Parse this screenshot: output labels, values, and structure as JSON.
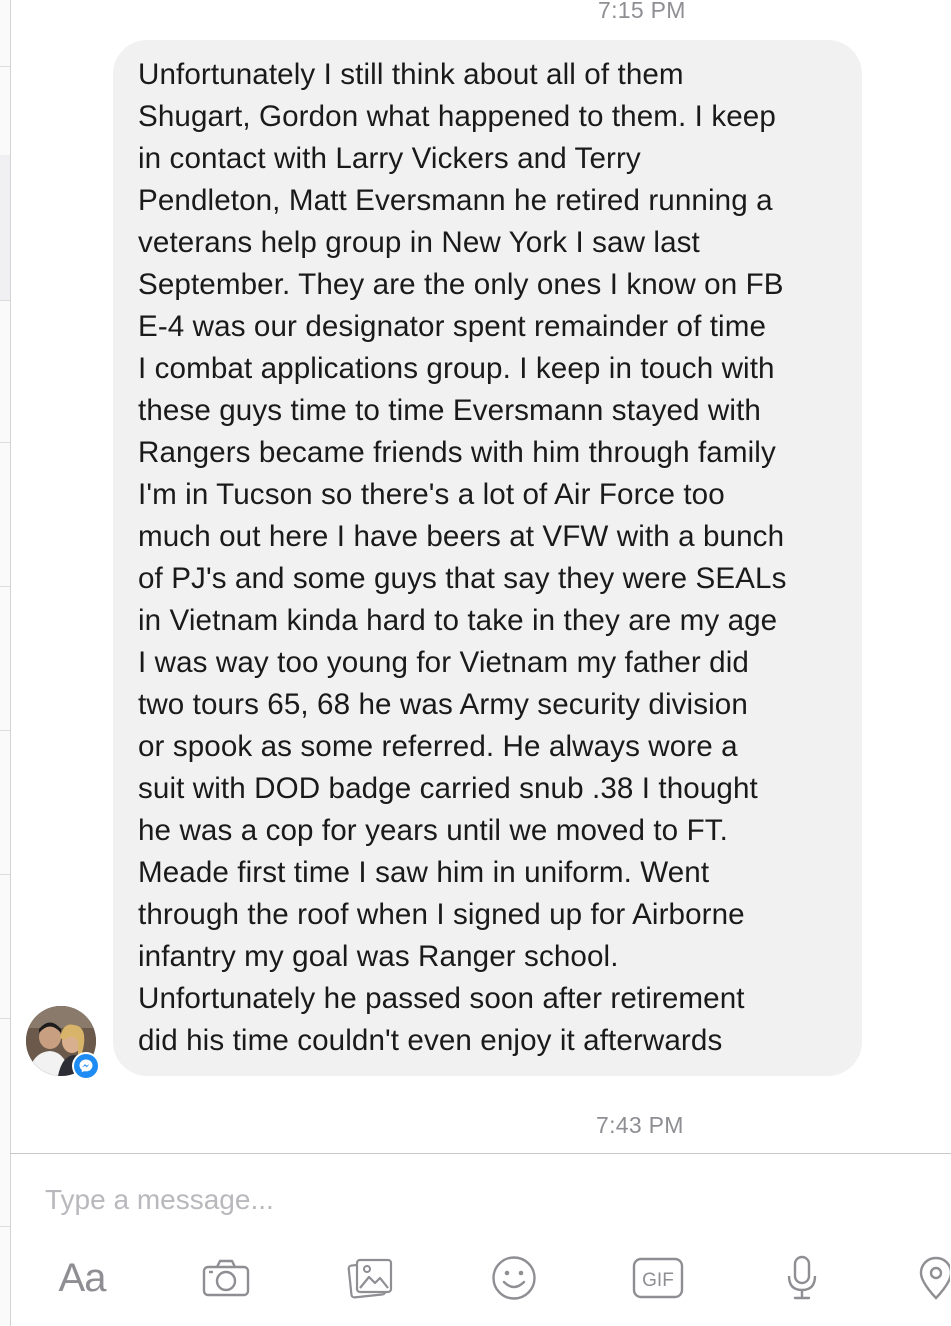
{
  "conversation": {
    "timestamp_top": "7:15 PM",
    "timestamp_bottom": "7:43 PM",
    "message": {
      "lines": [
        "Unfortunately I still think about all of them",
        "Shugart, Gordon what happened to them. I keep",
        "in contact with Larry Vickers and Terry",
        "Pendleton, Matt Eversmann he retired running a",
        "veterans help group in New York I saw last",
        "September. They are the only ones I know on FB",
        "E-4 was our designator spent remainder of time",
        "I combat applications group. I keep in touch with",
        "these guys time to time Eversmann stayed with",
        "Rangers became friends with him through family",
        "I'm in Tucson so there's a lot of Air Force too",
        "much out here I have beers at VFW with a bunch",
        "of PJ's and some guys that say they were SEALs",
        "in Vietnam kinda hard to take in they are my age",
        "I was way too young for Vietnam my father did",
        "two tours 65, 68 he was Army security division",
        "or spook as some referred. He always wore a",
        "suit with DOD badge carried snub .38 I thought",
        "he was a cop for years until we moved to FT.",
        "Meade first time I saw him in uniform. Went",
        "through the roof when I signed up for Airborne",
        "infantry my goal was Ranger school.",
        "Unfortunately he passed soon after retirement",
        "did his time couldn't even enjoy it afterwards"
      ]
    }
  },
  "composer": {
    "placeholder": "Type a message...",
    "value": "",
    "text_format_label": "Aa",
    "gif_label": "GIF",
    "icons": [
      "text-format-icon",
      "camera-icon",
      "photo-gallery-icon",
      "emoji-icon",
      "gif-icon",
      "microphone-icon",
      "location-pin-icon"
    ]
  },
  "colors": {
    "bubble_background": "#f1f1f1",
    "message_text": "#1a1a1a",
    "timestamp": "#8e8e93",
    "icon_gray": "#8e8e93",
    "placeholder": "#b8b8bd",
    "messenger_badge": "#1e8cf2"
  }
}
